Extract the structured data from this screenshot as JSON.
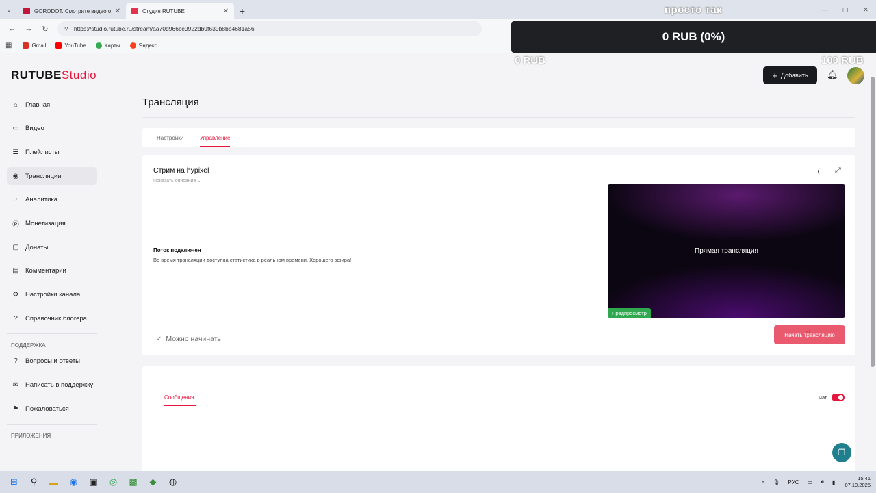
{
  "browser": {
    "tabs": [
      {
        "title": "GORODOT. Смотрите видео он...",
        "active": false
      },
      {
        "title": "Студия RUTUBE",
        "active": true
      }
    ],
    "url": "https://studio.rutube.ru/stream/aa70d966ce9922db9f639b8bb4681a56",
    "bookmarks": [
      "Gmail",
      "YouTube",
      "Карты",
      "Яндекс"
    ]
  },
  "overlay": {
    "title": "просто так",
    "amount": "0 RUB (0%)",
    "min_label": "0 RUB",
    "max_label": "100 RUB",
    "progress": 0
  },
  "header": {
    "logo_main": "RUTUBE",
    "logo_sub": "Studio",
    "add_label": "Добавить"
  },
  "sidebar": {
    "items": [
      {
        "label": "Главная",
        "icon": "home-icon",
        "glyph": "⌂"
      },
      {
        "label": "Видео",
        "icon": "video-icon",
        "glyph": "▭"
      },
      {
        "label": "Плейлисты",
        "icon": "playlist-icon",
        "glyph": "☰"
      },
      {
        "label": "Трансляции",
        "icon": "broadcast-icon",
        "glyph": "◉"
      },
      {
        "label": "Аналитика",
        "icon": "analytics-icon",
        "glyph": "◔"
      },
      {
        "label": "Монетизация",
        "icon": "monetization-icon",
        "glyph": "Ⓟ"
      },
      {
        "label": "Донаты",
        "icon": "donate-icon",
        "glyph": "▢"
      },
      {
        "label": "Комментарии",
        "icon": "comments-icon",
        "glyph": "▤"
      },
      {
        "label": "Настройки канала",
        "icon": "gear-icon",
        "glyph": "⚙"
      },
      {
        "label": "Справочник блогера",
        "icon": "help-icon",
        "glyph": "?"
      }
    ],
    "active_index": 3,
    "support_heading": "ПОДДЕРЖКА",
    "support_items": [
      {
        "label": "Вопросы и ответы",
        "icon": "faq-icon",
        "glyph": "?"
      },
      {
        "label": "Написать в поддержку",
        "icon": "mail-icon",
        "glyph": "✉"
      },
      {
        "label": "Пожаловаться",
        "icon": "flag-icon",
        "glyph": "⚑"
      }
    ],
    "apps_heading": "ПРИЛОЖЕНИЯ"
  },
  "main": {
    "page_title": "Трансляция",
    "tabs": [
      {
        "label": "Настройки",
        "active": false
      },
      {
        "label": "Управление",
        "active": true
      }
    ],
    "stream_title": "Стрим на hypixel",
    "show_description": "Показать описание",
    "connection_title": "Поток подключен",
    "connection_desc": "Во время трансляции доступна статистика в реальном времени. Хорошего эфира!",
    "ready_label": "Можно начинать",
    "preview_label": "Прямая трансляция",
    "preview_badge": "Предпросмотр",
    "start_button": "Начать трансляцию"
  },
  "chat": {
    "tab_label": "Сообщения",
    "chat_label": "Чат",
    "chat_enabled": true
  },
  "taskbar": {
    "language": "РУС",
    "time": "15:41",
    "date": "07.10.2025"
  },
  "colors": {
    "accent": "#e5163e",
    "start_button": "#ea5a6f",
    "preview_badge": "#2fa84f",
    "overlay_bg": "#1f2024"
  }
}
